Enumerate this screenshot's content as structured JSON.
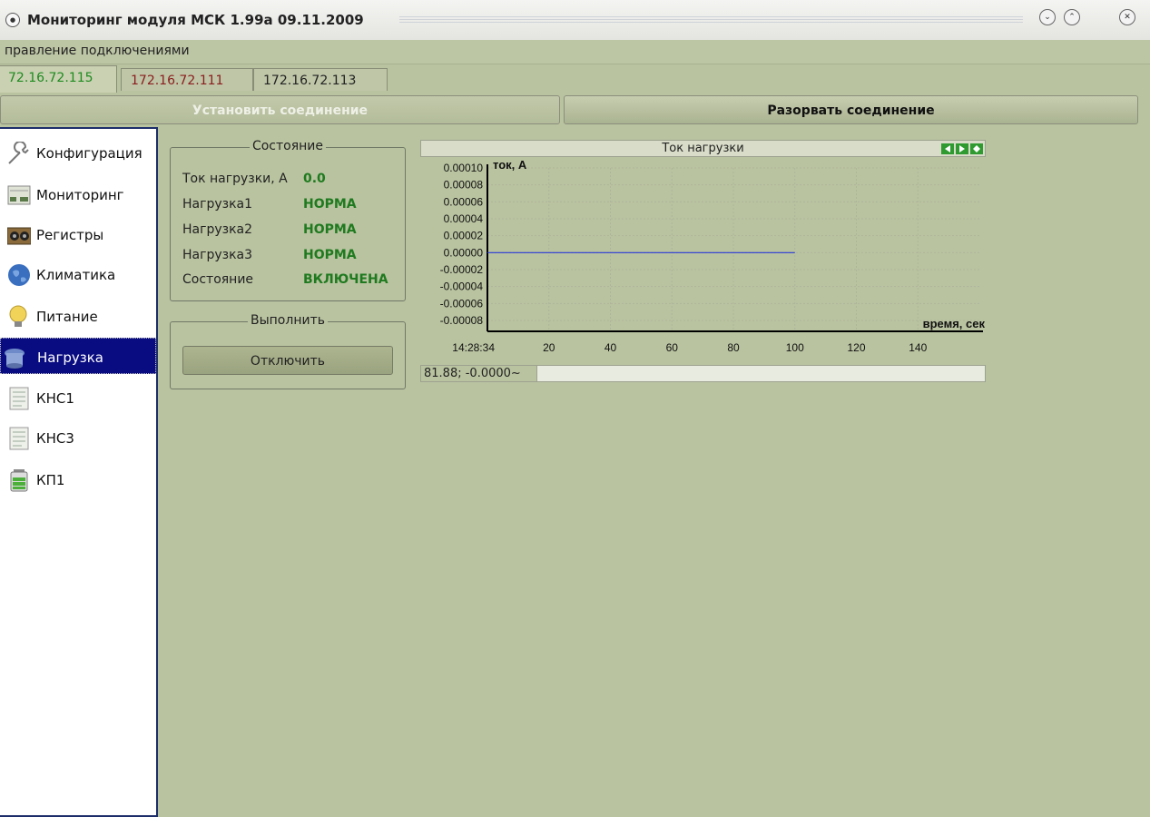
{
  "window": {
    "title": "Мониторинг модуля МСК 1.99a 09.11.2009",
    "min_icon": "chevron-down-circle-icon",
    "max_icon": "chevron-up-circle-icon",
    "close_icon": "close-circle-icon"
  },
  "menu": {
    "connections": "правление подключениями"
  },
  "tabs": [
    {
      "label": "72.16.72.115",
      "color": "#1f8a1f",
      "active": true
    },
    {
      "label": "172.16.72.111",
      "color": "#8b1d1d",
      "active": false
    },
    {
      "label": "172.16.72.113",
      "color": "#222222",
      "active": false
    }
  ],
  "connection": {
    "connect_label": "Установить соединение",
    "disconnect_label": "Разорвать соединение"
  },
  "sidebar": {
    "items": [
      {
        "label": "Конфигурация",
        "icon": "wrench-icon"
      },
      {
        "label": "Мониторинг",
        "icon": "monitor-panel-icon"
      },
      {
        "label": "Регистры",
        "icon": "registers-icon"
      },
      {
        "label": "Климатика",
        "icon": "globe-icon"
      },
      {
        "label": "Питание",
        "icon": "lightbulb-icon"
      },
      {
        "label": "Нагрузка",
        "icon": "load-icon",
        "selected": true
      },
      {
        "label": "КНС1",
        "icon": "document-icon"
      },
      {
        "label": "КНС3",
        "icon": "document-icon"
      },
      {
        "label": "КП1",
        "icon": "battery-icon"
      }
    ]
  },
  "state": {
    "title": "Состояние",
    "rows": [
      {
        "label": "Ток нагрузки, А",
        "value": "0.0"
      },
      {
        "label": "Нагрузка1",
        "value": "НОРМА"
      },
      {
        "label": "Нагрузка2",
        "value": "НОРМА"
      },
      {
        "label": "Нагрузка3",
        "value": "НОРМА"
      },
      {
        "label": "Состояние",
        "value": "ВКЛЮЧЕНА"
      }
    ]
  },
  "execute": {
    "title": "Выполнить",
    "button_label": "Отключить"
  },
  "chart_status": {
    "coord": "81.88; -0.0000~"
  },
  "colors": {
    "background": "#b9c3a0",
    "ok_value": "#1f7a1f",
    "selected_item": "#090b80",
    "series_line": "#2a36d8"
  },
  "chart_data": {
    "type": "line",
    "title": "Ток нагрузки",
    "xlabel": "время, сек",
    "ylabel": "ток, А",
    "x_start_label": "14:28:34",
    "x_ticks": [
      20,
      40,
      60,
      80,
      100,
      120,
      140
    ],
    "y_ticks": [
      "0.00010",
      "0.00008",
      "0.00006",
      "0.00004",
      "0.00002",
      "0.00000",
      "-0.00002",
      "-0.00004",
      "-0.00006",
      "-0.00008"
    ],
    "xlim": [
      0,
      160
    ],
    "ylim": [
      -9e-05,
      0.0001
    ],
    "grid": true,
    "series": [
      {
        "x": [
          0,
          100
        ],
        "y": [
          0.0,
          0.0
        ],
        "color": "#2a36d8"
      }
    ]
  }
}
